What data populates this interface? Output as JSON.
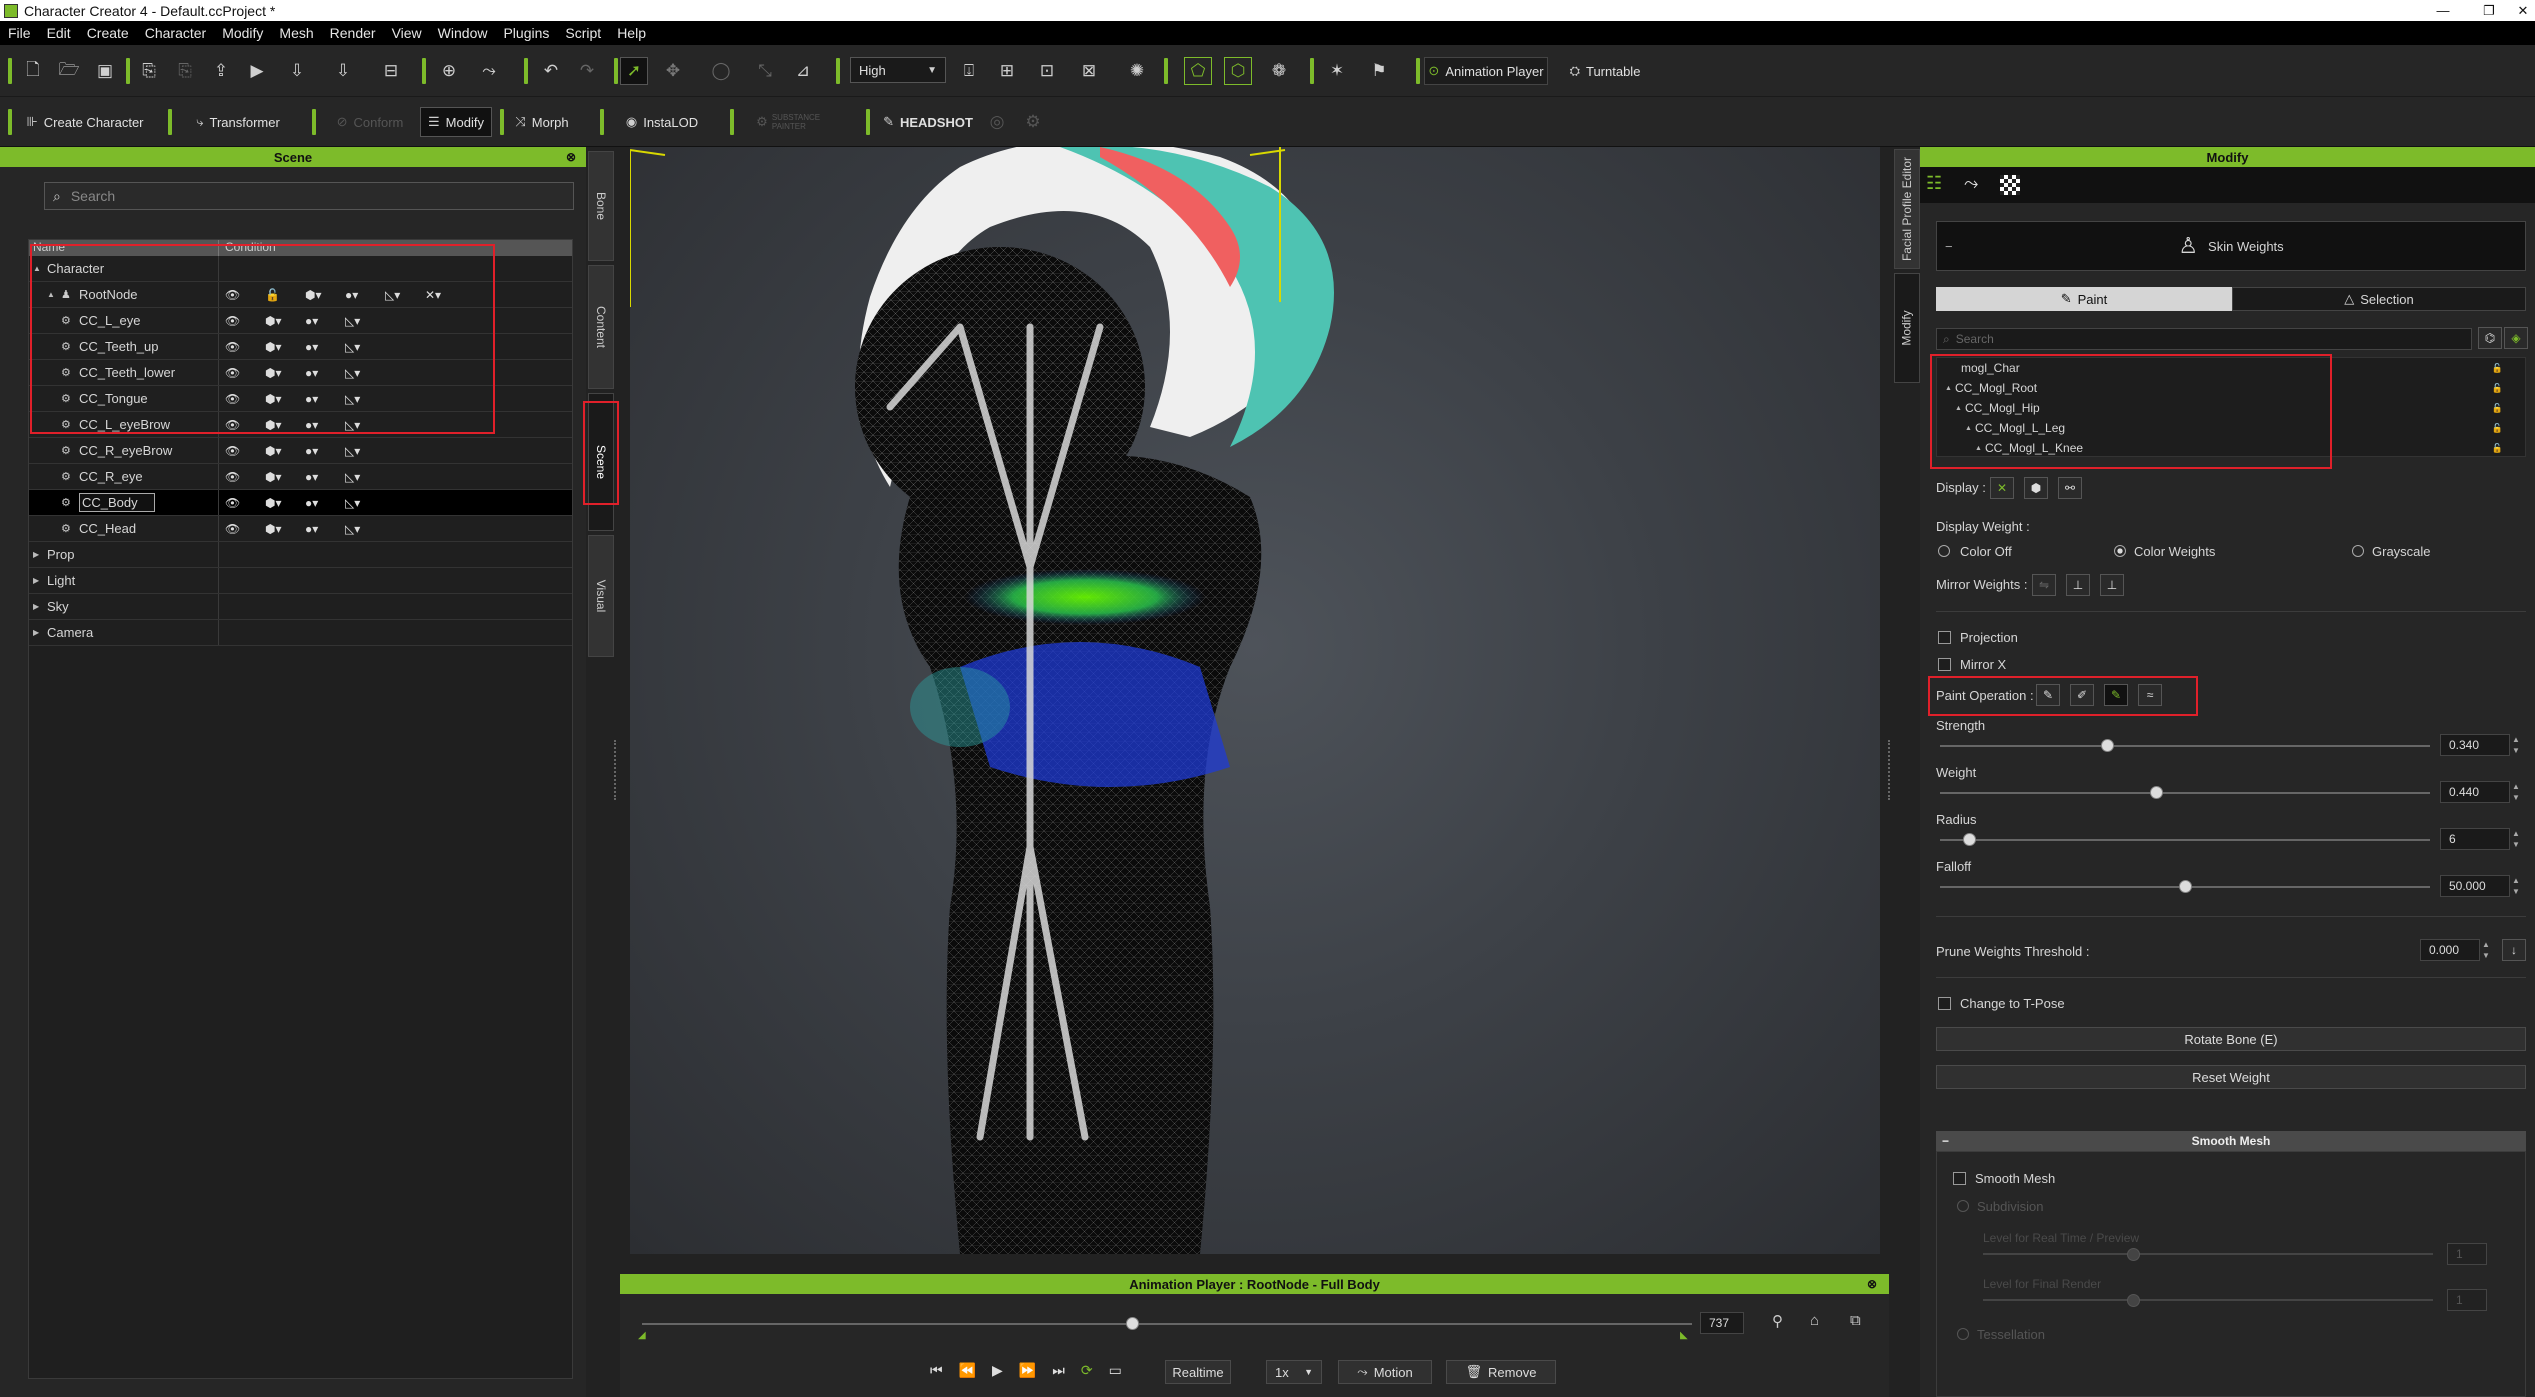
{
  "app": {
    "title": "Character Creator 4 - Default.ccProject *"
  },
  "menu": [
    "File",
    "Edit",
    "Create",
    "Character",
    "Modify",
    "Mesh",
    "Render",
    "View",
    "Window",
    "Plugins",
    "Script",
    "Help"
  ],
  "toolbar": {
    "quality": "High",
    "animation_player": "Animation Player",
    "turntable": "Turntable"
  },
  "toolbar2": {
    "create_character": "Create Character",
    "transformer": "Transformer",
    "conform": "Conform",
    "modify": "Modify",
    "morph": "Morph",
    "instalod": "InstaLOD",
    "substance": "SUBSTANCE PAINTER",
    "headshot": "HEADSHOT"
  },
  "scene": {
    "title": "Scene",
    "search_placeholder": "Search",
    "col_name": "Name",
    "col_condition": "Condition",
    "rows": [
      {
        "label": "Character",
        "indent": 0,
        "arrow": "▲"
      },
      {
        "label": "RootNode",
        "indent": 1,
        "arrow": "▲"
      },
      {
        "label": "CC_L_eye",
        "indent": 2
      },
      {
        "label": "CC_Teeth_up",
        "indent": 2
      },
      {
        "label": "CC_Teeth_lower",
        "indent": 2
      },
      {
        "label": "CC_Tongue",
        "indent": 2
      },
      {
        "label": "CC_L_eyeBrow",
        "indent": 2
      },
      {
        "label": "CC_R_eyeBrow",
        "indent": 2
      },
      {
        "label": "CC_R_eye",
        "indent": 2
      },
      {
        "label": "CC_Body",
        "indent": 2,
        "selected": true
      },
      {
        "label": "CC_Head",
        "indent": 2
      },
      {
        "label": "Prop",
        "indent": 0,
        "arrow": "▶"
      },
      {
        "label": "Light",
        "indent": 0,
        "arrow": "▶"
      },
      {
        "label": "Sky",
        "indent": 0,
        "arrow": "▶"
      },
      {
        "label": "Camera",
        "indent": 0,
        "arrow": "▶"
      }
    ]
  },
  "side_tabs": {
    "bone": "Bone",
    "content": "Content",
    "scene": "Scene",
    "visual": "Visual"
  },
  "right_tabs": {
    "facial": "Facial Profile Editor",
    "modify": "Modify"
  },
  "anim": {
    "title": "Animation Player : RootNode - Full Body",
    "frame": "737",
    "realtime": "Realtime",
    "speed": "1x",
    "motion": "Motion",
    "remove": "Remove"
  },
  "modify": {
    "title": "Modify",
    "skin_weights": "Skin Weights",
    "paint_tab": "Paint",
    "selection_tab": "Selection",
    "search_placeholder": "Search",
    "bones": [
      {
        "label": "mogl_Char",
        "indent": 0,
        "arrow": ""
      },
      {
        "label": "CC_Mogl_Root",
        "indent": 0,
        "arrow": "▲"
      },
      {
        "label": "CC_Mogl_Hip",
        "indent": 1,
        "arrow": "▲"
      },
      {
        "label": "CC_Mogl_L_Leg",
        "indent": 2,
        "arrow": "▲"
      },
      {
        "label": "CC_Mogl_L_Knee",
        "indent": 3,
        "arrow": "▲"
      }
    ],
    "display": "Display :",
    "display_weight": "Display Weight :",
    "color_off": "Color Off",
    "color_weights": "Color Weights",
    "grayscale": "Grayscale",
    "mirror_weights": "Mirror Weights :",
    "projection": "Projection",
    "mirror_x": "Mirror X",
    "paint_operation": "Paint Operation :",
    "strength_label": "Strength",
    "strength": "0.340",
    "strength_frac": 0.34,
    "weight_label": "Weight",
    "weight": "0.440",
    "weight_frac": 0.44,
    "radius_label": "Radius",
    "radius": "6",
    "radius_frac": 0.06,
    "falloff_label": "Falloff",
    "falloff": "50.000",
    "falloff_frac": 0.5,
    "prune_label": "Prune Weights Threshold :",
    "prune": "0.000",
    "tpose": "Change to T-Pose",
    "rotate_bone": "Rotate Bone (E)",
    "reset_weight": "Reset Weight",
    "smooth_mesh_header": "Smooth Mesh",
    "smooth_mesh": "Smooth Mesh",
    "subdivision": "Subdivision",
    "level_realtime": "Level for Real Time / Preview",
    "level_final": "Level for Final Render",
    "tessellation": "Tessellation",
    "level_value": "1"
  },
  "colors": {
    "accent": "#7dbb2a",
    "highlight": "#e0202a"
  }
}
